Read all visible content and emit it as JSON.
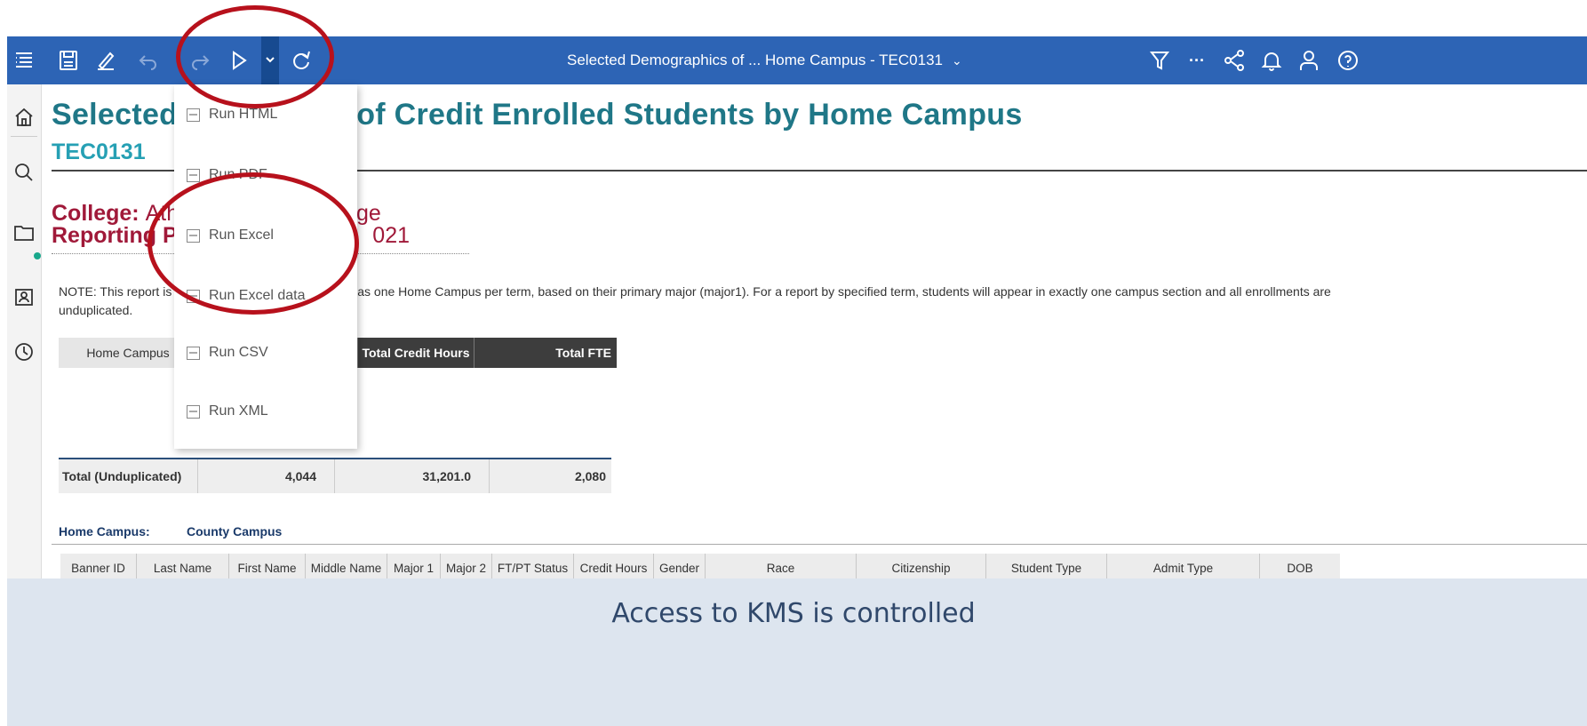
{
  "toolbar": {
    "report_title": "Selected Demographics of ... Home Campus - TEC0131",
    "title_chevron": "⌄",
    "more_label": "···"
  },
  "report": {
    "title_left": "Selected",
    "title_right": "s of Credit Enrolled Students by Home Campus",
    "code": "TEC0131",
    "college_label": "College:",
    "college_value": "Athe",
    "college_value_right": "ge",
    "reporting_label": "Reporting Per",
    "reporting_value_right": "021",
    "note_left": "NOTE:  This report is",
    "note_right": "dent has one Home Campus per term, based on their primary major (major1). For a report by specified term, students will appear in exactly one campus section and all enrollments are",
    "note_line2": "unduplicated."
  },
  "summary": {
    "home_campus_header": "Home Campus",
    "total_credit_hours_header": "Total Credit Hours",
    "total_fte_header": "Total FTE",
    "partial_text": "us",
    "total_label": "Total (Unduplicated)",
    "total_students": "4,044",
    "total_credit_hours": "31,201.0",
    "total_fte": "2,080"
  },
  "campus_section": {
    "label": "Home Campus:",
    "value": "County Campus"
  },
  "detail_columns": [
    "Banner ID",
    "Last Name",
    "First Name",
    "Middle Name",
    "Major 1",
    "Major 2",
    "FT/PT Status",
    "Credit Hours",
    "Gender",
    "Race",
    "Citizenship",
    "Student Type",
    "Admit Type",
    "DOB"
  ],
  "run_menu": {
    "items": [
      "Run HTML",
      "Run PDF",
      "Run Excel",
      "Run Excel data",
      "Run CSV",
      "Run XML"
    ]
  },
  "caption": "Access to KMS is controlled",
  "colors": {
    "toolbar": "#2d64b5",
    "title": "#1f7787",
    "college": "#a01939",
    "highlight_circle": "#b7111c",
    "caption_bg": "#dde5ef"
  }
}
